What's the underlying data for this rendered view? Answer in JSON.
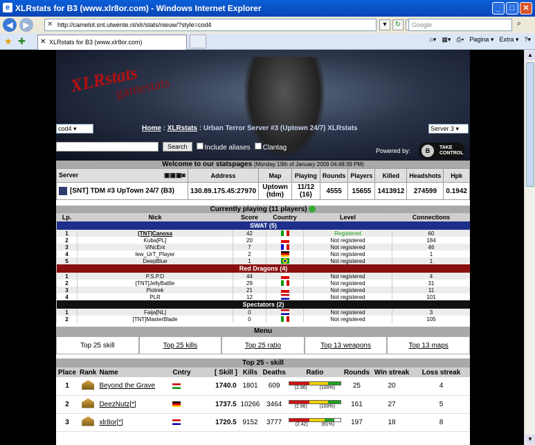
{
  "window": {
    "title": "XLRstats for B3 (www.xlr8or.com) - Windows Internet Explorer"
  },
  "address": {
    "url": "http://camelot.snt.utwente.nl/xlr/stats/nieuw/?style=cod4",
    "search_placeholder": "Google"
  },
  "tab": {
    "label": "XLRstats for B3 (www.xlr8or.com)"
  },
  "tools": {
    "page": "Pagina",
    "extra": "Extra"
  },
  "header": {
    "style_select": "cod4",
    "server_select": "Server 3",
    "home": "Home",
    "xlrstats": "XLRstats",
    "crumb_rest": "Urban Terror Server #3 (Uptown 24/7) XLRstats",
    "search_button": "Search",
    "include_aliases": "Include aliases",
    "clantag": "Clantag",
    "powered_by": "Powered by:",
    "logo_letter": "B",
    "logo_line1": "TAKE",
    "logo_line2": "CONTROL"
  },
  "welcome": {
    "title": "Welcome to our statspages",
    "date": "(Monday 19th of January 2009 04:48:39 PM)"
  },
  "server_table": {
    "labels": [
      "Server",
      "Address",
      "Map",
      "Playing",
      "Rounds",
      "Players",
      "Killed",
      "Headshots",
      "Hpk"
    ],
    "name": "[SNT] TDM #3 UpTown 24/7 (B3)",
    "address": "130.89.175.45:27970",
    "map": "Uptown (tdm)",
    "playing": "11/12 (16)",
    "rounds": "4555",
    "players": "15655",
    "killed": "1413912",
    "headshots": "274599",
    "hpk": "0.1942"
  },
  "currently_playing": {
    "title": "Currently playing (11 players)",
    "columns": [
      "Lp.",
      "Nick",
      "Score",
      "Country",
      "Level",
      "Connections"
    ],
    "teams": [
      {
        "name": "SWAT (5)",
        "players": [
          {
            "lp": "1",
            "nick": "[TNT]Canosa",
            "score": "42",
            "flag": "it",
            "level": "Registered",
            "conn": "60"
          },
          {
            "lp": "2",
            "nick": "Kuba[PL]",
            "score": "20",
            "flag": "pl",
            "level": "Not registered",
            "conn": "184"
          },
          {
            "lp": "3",
            "nick": "ViNcEnt",
            "score": "7",
            "flag": "fr",
            "level": "Not registered",
            "conn": "46"
          },
          {
            "lp": "4",
            "nick": "lew_UrT_Player",
            "score": "2",
            "flag": "de",
            "level": "Not registered",
            "conn": "1"
          },
          {
            "lp": "5",
            "nick": "DeepBlue",
            "score": "1",
            "flag": "br",
            "level": "Not registered",
            "conn": "1"
          }
        ]
      },
      {
        "name": "Red Dragons (4)",
        "players": [
          {
            "lp": "1",
            "nick": "P.S.P.D",
            "score": "44",
            "flag": "pl",
            "level": "Not registered",
            "conn": "4"
          },
          {
            "lp": "2",
            "nick": "[TNT]JellyBattle",
            "score": "29",
            "flag": "it",
            "level": "Not registered",
            "conn": "31"
          },
          {
            "lp": "3",
            "nick": "Piotrek",
            "score": "21",
            "flag": "pl",
            "level": "Not registered",
            "conn": "11"
          },
          {
            "lp": "4",
            "nick": "PLR",
            "score": "12",
            "flag": "nl",
            "level": "Not registered",
            "conn": "101"
          }
        ]
      },
      {
        "name": "Spectators (2)",
        "players": [
          {
            "lp": "1",
            "nick": "Faija[NL]",
            "score": "0",
            "flag": "nl",
            "level": "Not registered",
            "conn": "3"
          },
          {
            "lp": "2",
            "nick": "[TNT]MasterBlade",
            "score": "0",
            "flag": "it",
            "level": "Not registered",
            "conn": "105"
          }
        ]
      }
    ]
  },
  "menu": {
    "title": "Menu",
    "items": [
      "Top 25 skill",
      "Top 25 kills",
      "Top 25 ratio",
      "Top 13 weapons",
      "Top 13 maps"
    ]
  },
  "top25": {
    "title": "Top 25 - skill",
    "columns": [
      "Place",
      "Rank",
      "Name",
      "Cntry",
      "[ Skill ]",
      "Kills",
      "Deaths",
      "Ratio",
      "Rounds",
      "Win streak",
      "Loss streak"
    ],
    "rows": [
      {
        "place": "1",
        "name": "Beyond the Grave",
        "flag": "hu",
        "skill": "1740.0",
        "kills": "1801",
        "deaths": "609",
        "ratio": "(2.96)",
        "pct": "(100%)",
        "rounds": "25",
        "win": "20",
        "loss": "4"
      },
      {
        "place": "2",
        "name": "DeezNutz[*]",
        "flag": "de",
        "skill": "1737.5",
        "kills": "10266",
        "deaths": "3464",
        "ratio": "(2.96)",
        "pct": "(100%)",
        "rounds": "161",
        "win": "27",
        "loss": "5"
      },
      {
        "place": "3",
        "name": "xlr8or[*]",
        "flag": "nl",
        "skill": "1720.5",
        "kills": "9152",
        "deaths": "3777",
        "ratio": "(2.42)",
        "pct": "(81%)",
        "rounds": "197",
        "win": "18",
        "loss": "8"
      }
    ]
  }
}
